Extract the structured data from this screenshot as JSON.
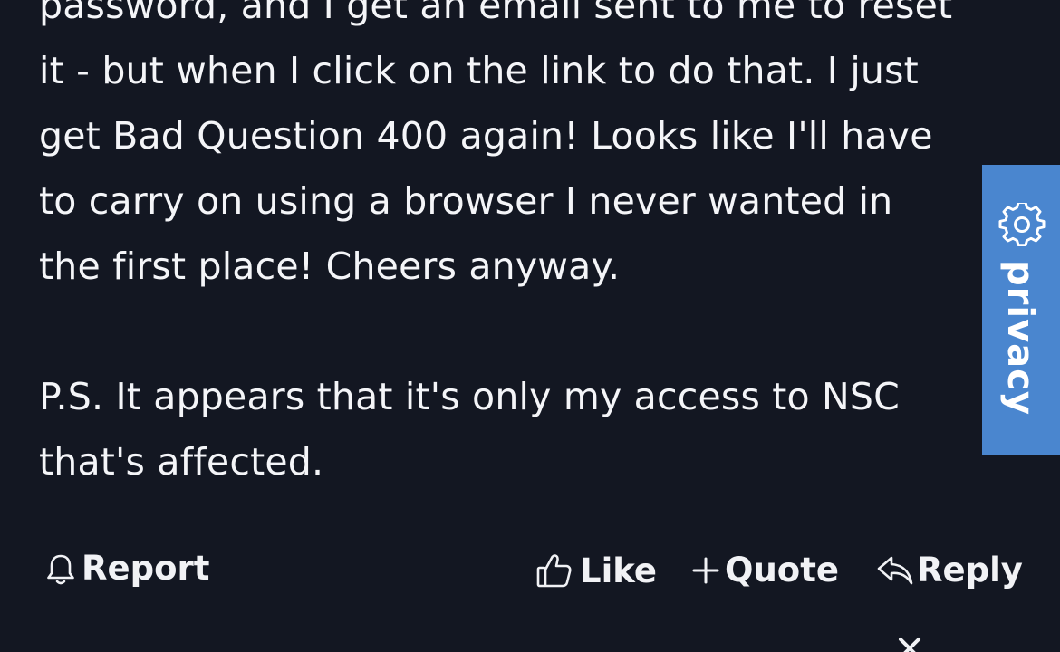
{
  "post": {
    "lines": [
      "password, and I get an email sent to me to reset",
      "it - but when I click on the link to do that. I just",
      "get Bad Question 400 again! Looks like I'll have",
      "to carry on using a browser I never wanted in",
      "the first place! Cheers anyway.",
      "P.S. It appears that it's only my access to NSC",
      "that's affected."
    ]
  },
  "actions": {
    "report_label": "Report",
    "like_label": "Like",
    "quote_label": "Quote",
    "reply_label": "Reply"
  },
  "privacy_tab": {
    "label": "privacy",
    "icon": "gear-icon"
  },
  "colors": {
    "background": "#131722",
    "text": "#f4f5f8",
    "privacy_tab": "#4a86cf"
  }
}
